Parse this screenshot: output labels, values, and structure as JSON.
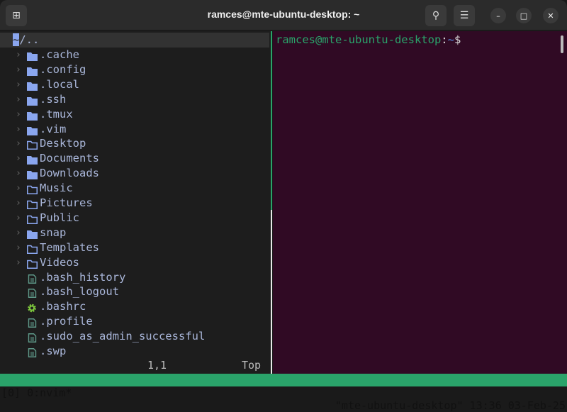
{
  "window": {
    "title": "ramces@mte-ubuntu-desktop: ~"
  },
  "tree": {
    "root": {
      "cursor": "~",
      "rest": "/.."
    },
    "items": [
      {
        "name": ".cache",
        "type": "dir",
        "filled": true
      },
      {
        "name": ".config",
        "type": "dir",
        "filled": true
      },
      {
        "name": ".local",
        "type": "dir",
        "filled": true
      },
      {
        "name": ".ssh",
        "type": "dir",
        "filled": true
      },
      {
        "name": ".tmux",
        "type": "dir",
        "filled": true
      },
      {
        "name": ".vim",
        "type": "dir",
        "filled": true
      },
      {
        "name": "Desktop",
        "type": "dir",
        "filled": false
      },
      {
        "name": "Documents",
        "type": "dir",
        "filled": true
      },
      {
        "name": "Downloads",
        "type": "dir",
        "filled": true
      },
      {
        "name": "Music",
        "type": "dir",
        "filled": false
      },
      {
        "name": "Pictures",
        "type": "dir",
        "filled": false
      },
      {
        "name": "Public",
        "type": "dir",
        "filled": false
      },
      {
        "name": "snap",
        "type": "dir",
        "filled": true
      },
      {
        "name": "Templates",
        "type": "dir",
        "filled": false
      },
      {
        "name": "Videos",
        "type": "dir",
        "filled": false
      },
      {
        "name": ".bash_history",
        "type": "file"
      },
      {
        "name": ".bash_logout",
        "type": "file"
      },
      {
        "name": ".bashrc",
        "type": "config"
      },
      {
        "name": ".profile",
        "type": "file"
      },
      {
        "name": ".sudo_as_admin_successful",
        "type": "file"
      },
      {
        "name": ".swp",
        "type": "file"
      }
    ],
    "position": "1,1",
    "scroll": "Top"
  },
  "terminal": {
    "user_host": "ramces@mte-ubuntu-desktop",
    "colon": ":",
    "path": "~",
    "symbol": "$"
  },
  "tmux": {
    "left": "[0] 0:nvim*",
    "right": "\"mte-ubuntu-desktop\" 13:36 03-Feb-25"
  },
  "colors": {
    "accent": "#2aa36a",
    "terminal_bg": "#300a24",
    "folder": "#8aa6ef",
    "file": "#5f9a8a",
    "config": "#7ec93d"
  }
}
